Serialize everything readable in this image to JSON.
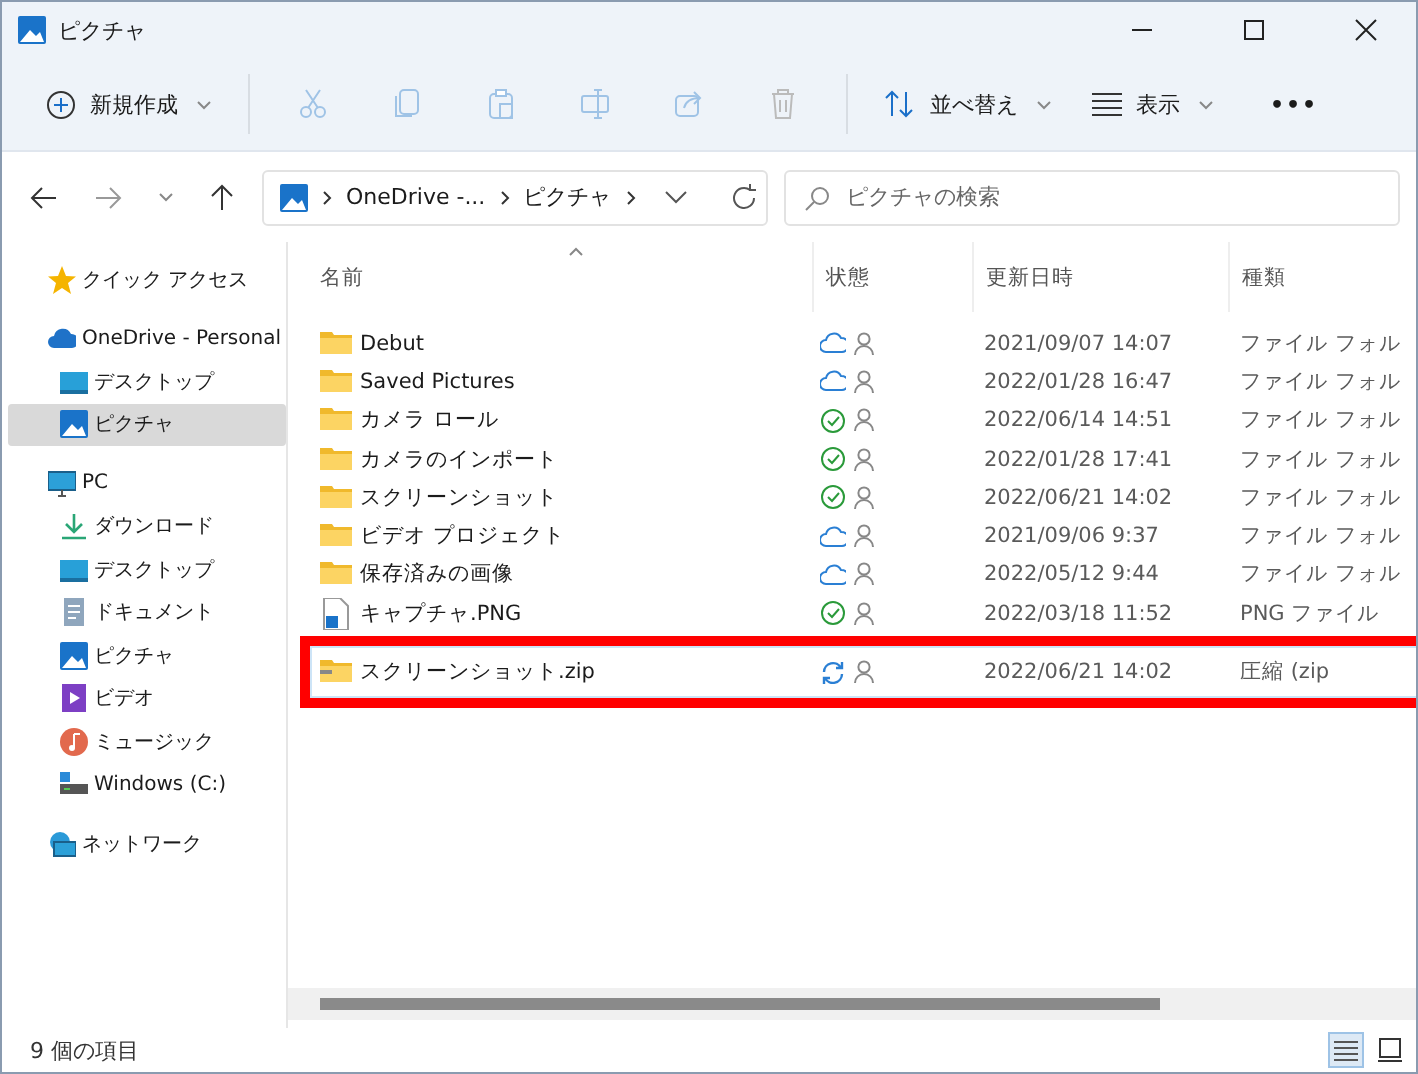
{
  "window": {
    "title": "ピクチャ"
  },
  "toolbar": {
    "new_button": "新規作成",
    "sort_button": "並べ替え",
    "view_button": "表示",
    "more_button": "•••"
  },
  "address_bar": {
    "segments": [
      "OneDrive -...",
      "ピクチャ"
    ]
  },
  "search": {
    "placeholder": "ピクチャの検索"
  },
  "sidebar": {
    "items": [
      {
        "label": "クイック アクセス",
        "kind": "star",
        "selected": false
      },
      {
        "label": "OneDrive - Personal",
        "kind": "cloud",
        "selected": false,
        "children": [
          {
            "label": "デスクトップ",
            "kind": "desktop",
            "selected": false
          },
          {
            "label": "ピクチャ",
            "kind": "pictures",
            "selected": true
          }
        ]
      },
      {
        "label": "PC",
        "kind": "pc",
        "selected": false,
        "children": [
          {
            "label": "ダウンロード",
            "kind": "download",
            "selected": false
          },
          {
            "label": "デスクトップ",
            "kind": "desktop",
            "selected": false
          },
          {
            "label": "ドキュメント",
            "kind": "documents",
            "selected": false
          },
          {
            "label": "ピクチャ",
            "kind": "pictures",
            "selected": false
          },
          {
            "label": "ビデオ",
            "kind": "video",
            "selected": false
          },
          {
            "label": "ミュージック",
            "kind": "music",
            "selected": false
          },
          {
            "label": "Windows (C:)",
            "kind": "drive",
            "selected": false
          }
        ]
      },
      {
        "label": "ネットワーク",
        "kind": "network",
        "selected": false
      }
    ]
  },
  "table": {
    "columns": [
      "名前",
      "状態",
      "更新日時",
      "種類"
    ],
    "rows": [
      {
        "name": "Debut",
        "kind": "folder",
        "sync_icon": {
          "kind": "cloud"
        },
        "modified": "2021/09/07 14:07",
        "type": "ファイル フォル",
        "highlighted": false
      },
      {
        "name": "Saved Pictures",
        "kind": "folder",
        "sync_icon": {
          "kind": "cloud"
        },
        "modified": "2022/01/28 16:47",
        "type": "ファイル フォル",
        "highlighted": false
      },
      {
        "name": "カメラ ロール",
        "kind": "folder",
        "sync_icon": {
          "kind": "synced"
        },
        "modified": "2022/06/14 14:51",
        "type": "ファイル フォル",
        "highlighted": false
      },
      {
        "name": "カメラのインポート",
        "kind": "folder",
        "sync_icon": {
          "kind": "synced"
        },
        "modified": "2022/01/28 17:41",
        "type": "ファイル フォル",
        "highlighted": false
      },
      {
        "name": "スクリーンショット",
        "kind": "folder",
        "sync_icon": {
          "kind": "synced"
        },
        "modified": "2022/06/21 14:02",
        "type": "ファイル フォル",
        "highlighted": false
      },
      {
        "name": "ビデオ プロジェクト",
        "kind": "folder",
        "sync_icon": {
          "kind": "cloud"
        },
        "modified": "2021/09/06 9:37",
        "type": "ファイル フォル",
        "highlighted": false
      },
      {
        "name": "保存済みの画像",
        "kind": "folder",
        "sync_icon": {
          "kind": "cloud"
        },
        "modified": "2022/05/12 9:44",
        "type": "ファイル フォル",
        "highlighted": false
      },
      {
        "name": "キャプチャ.PNG",
        "kind": "image",
        "sync_icon": {
          "kind": "synced"
        },
        "modified": "2022/03/18 11:52",
        "type": "PNG ファイル",
        "highlighted": false
      },
      {
        "name": "スクリーンショット.zip",
        "kind": "zip",
        "sync_icon": {
          "kind": "syncing"
        },
        "modified": "2022/06/21 14:02",
        "type": "圧縮 (zip",
        "highlighted": true
      }
    ]
  },
  "status_bar": {
    "count": "9 個の項目"
  }
}
